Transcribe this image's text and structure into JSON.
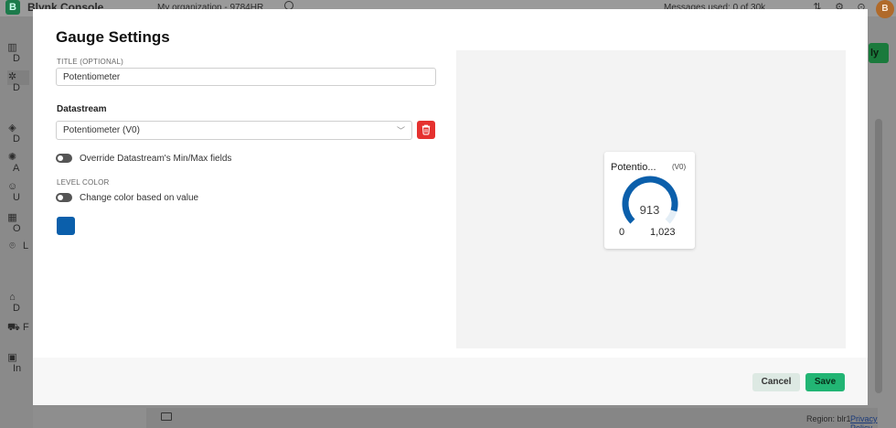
{
  "background": {
    "app_logo_letter": "B",
    "app_title": "Blynk.Console",
    "org_selector": "My organization - 9784HR",
    "messages_text": "Messages used: 0 of 30k",
    "avatar_letter": "B",
    "sidebar_items": [
      {
        "icon": "dashboard-icon",
        "label": "D"
      },
      {
        "icon": "developer-zone-icon",
        "label": "D"
      },
      {
        "icon": "devices-icon",
        "label": "D"
      },
      {
        "icon": "automations-icon",
        "label": "A"
      },
      {
        "icon": "users-icon",
        "label": "U"
      },
      {
        "icon": "organizations-icon",
        "label": "O"
      },
      {
        "icon": "locations-icon",
        "label": "L"
      },
      {
        "icon": "in-app-messaging-icon",
        "label": "D"
      },
      {
        "icon": "fleet-management-icon",
        "label": "F"
      },
      {
        "icon": "installer-tool-icon",
        "label": "In"
      }
    ],
    "right_button_label": "ly",
    "footer": {
      "region": "Region: blr1",
      "privacy": "Privacy Policy"
    }
  },
  "modal": {
    "title": "Gauge Settings",
    "title_field": {
      "label": "TITLE (OPTIONAL)",
      "value": "Potentiometer"
    },
    "datastream": {
      "label": "Datastream",
      "selected": "Potentiometer (V0)"
    },
    "override_toggle": {
      "label": "Override Datastream's Min/Max fields",
      "on": false
    },
    "level_color": {
      "section_label": "LEVEL COLOR",
      "toggle_label": "Change color based on value",
      "on": false,
      "color": "#0b5fab"
    },
    "preview": {
      "title": "Potentio...",
      "pin": "(V0)",
      "value": "913",
      "min": "0",
      "max": "1,023",
      "fraction": 0.8925,
      "arc_color": "#0b5fab",
      "track_color": "#e4eef6"
    },
    "buttons": {
      "cancel": "Cancel",
      "save": "Save"
    }
  },
  "colors": {
    "accent": "#22b574",
    "danger": "#e5312f",
    "brand": "#1c7a4b"
  }
}
